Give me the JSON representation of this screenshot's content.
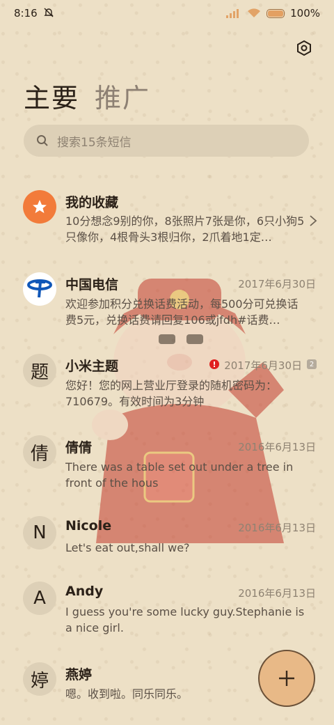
{
  "status_bar": {
    "time": "8:16",
    "battery": "100%"
  },
  "tabs": [
    {
      "label": "主要"
    },
    {
      "label": "推广"
    }
  ],
  "search": {
    "placeholder": "搜索15条短信"
  },
  "conversations": [
    {
      "name": "我的收藏",
      "avatar_type": "favorites-star",
      "date": "",
      "preview": "10分想念9别的你，8张照片7张是你，6只小狗5只像你，4根骨头3根归你，2爪着地1定…"
    },
    {
      "name": "中国电信",
      "avatar_type": "china-telecom-logo",
      "date": "2017年6月30日",
      "preview": "欢迎参加积分兑换话费活动，每500分可兑换话费5元，兑换话费请回复106或jfdh#话费…"
    },
    {
      "name": "小米主题",
      "avatar_letter": "题",
      "date": "2017年6月30日",
      "sim": "2",
      "preview": "您好！您的网上营业厅登录的随机密码为：710679。有效时间为3分钟"
    },
    {
      "name": "倩倩",
      "avatar_letter": "倩",
      "date": "2016年6月13日",
      "preview": "There was a table set out under a tree in front of the hous"
    },
    {
      "name": "Nicole",
      "avatar_letter": "N",
      "date": "2016年6月13日",
      "preview": "Let's eat out,shall we?"
    },
    {
      "name": "Andy",
      "avatar_letter": "A",
      "date": "2016年6月13日",
      "preview": "I guess you're some lucky guy.Stephanie is a nice girl."
    },
    {
      "name": "燕婷",
      "avatar_letter": "婷",
      "date": "201",
      "preview": "嗯。收到啦。同乐同乐。"
    }
  ],
  "colors": {
    "background": "#ede0c6",
    "accent": "#e8b987",
    "favorite": "#f27b3a"
  },
  "icons": {
    "settings": "gear-icon",
    "search": "search-icon",
    "fab": "plus-icon",
    "mute": "mute-bell-icon"
  }
}
